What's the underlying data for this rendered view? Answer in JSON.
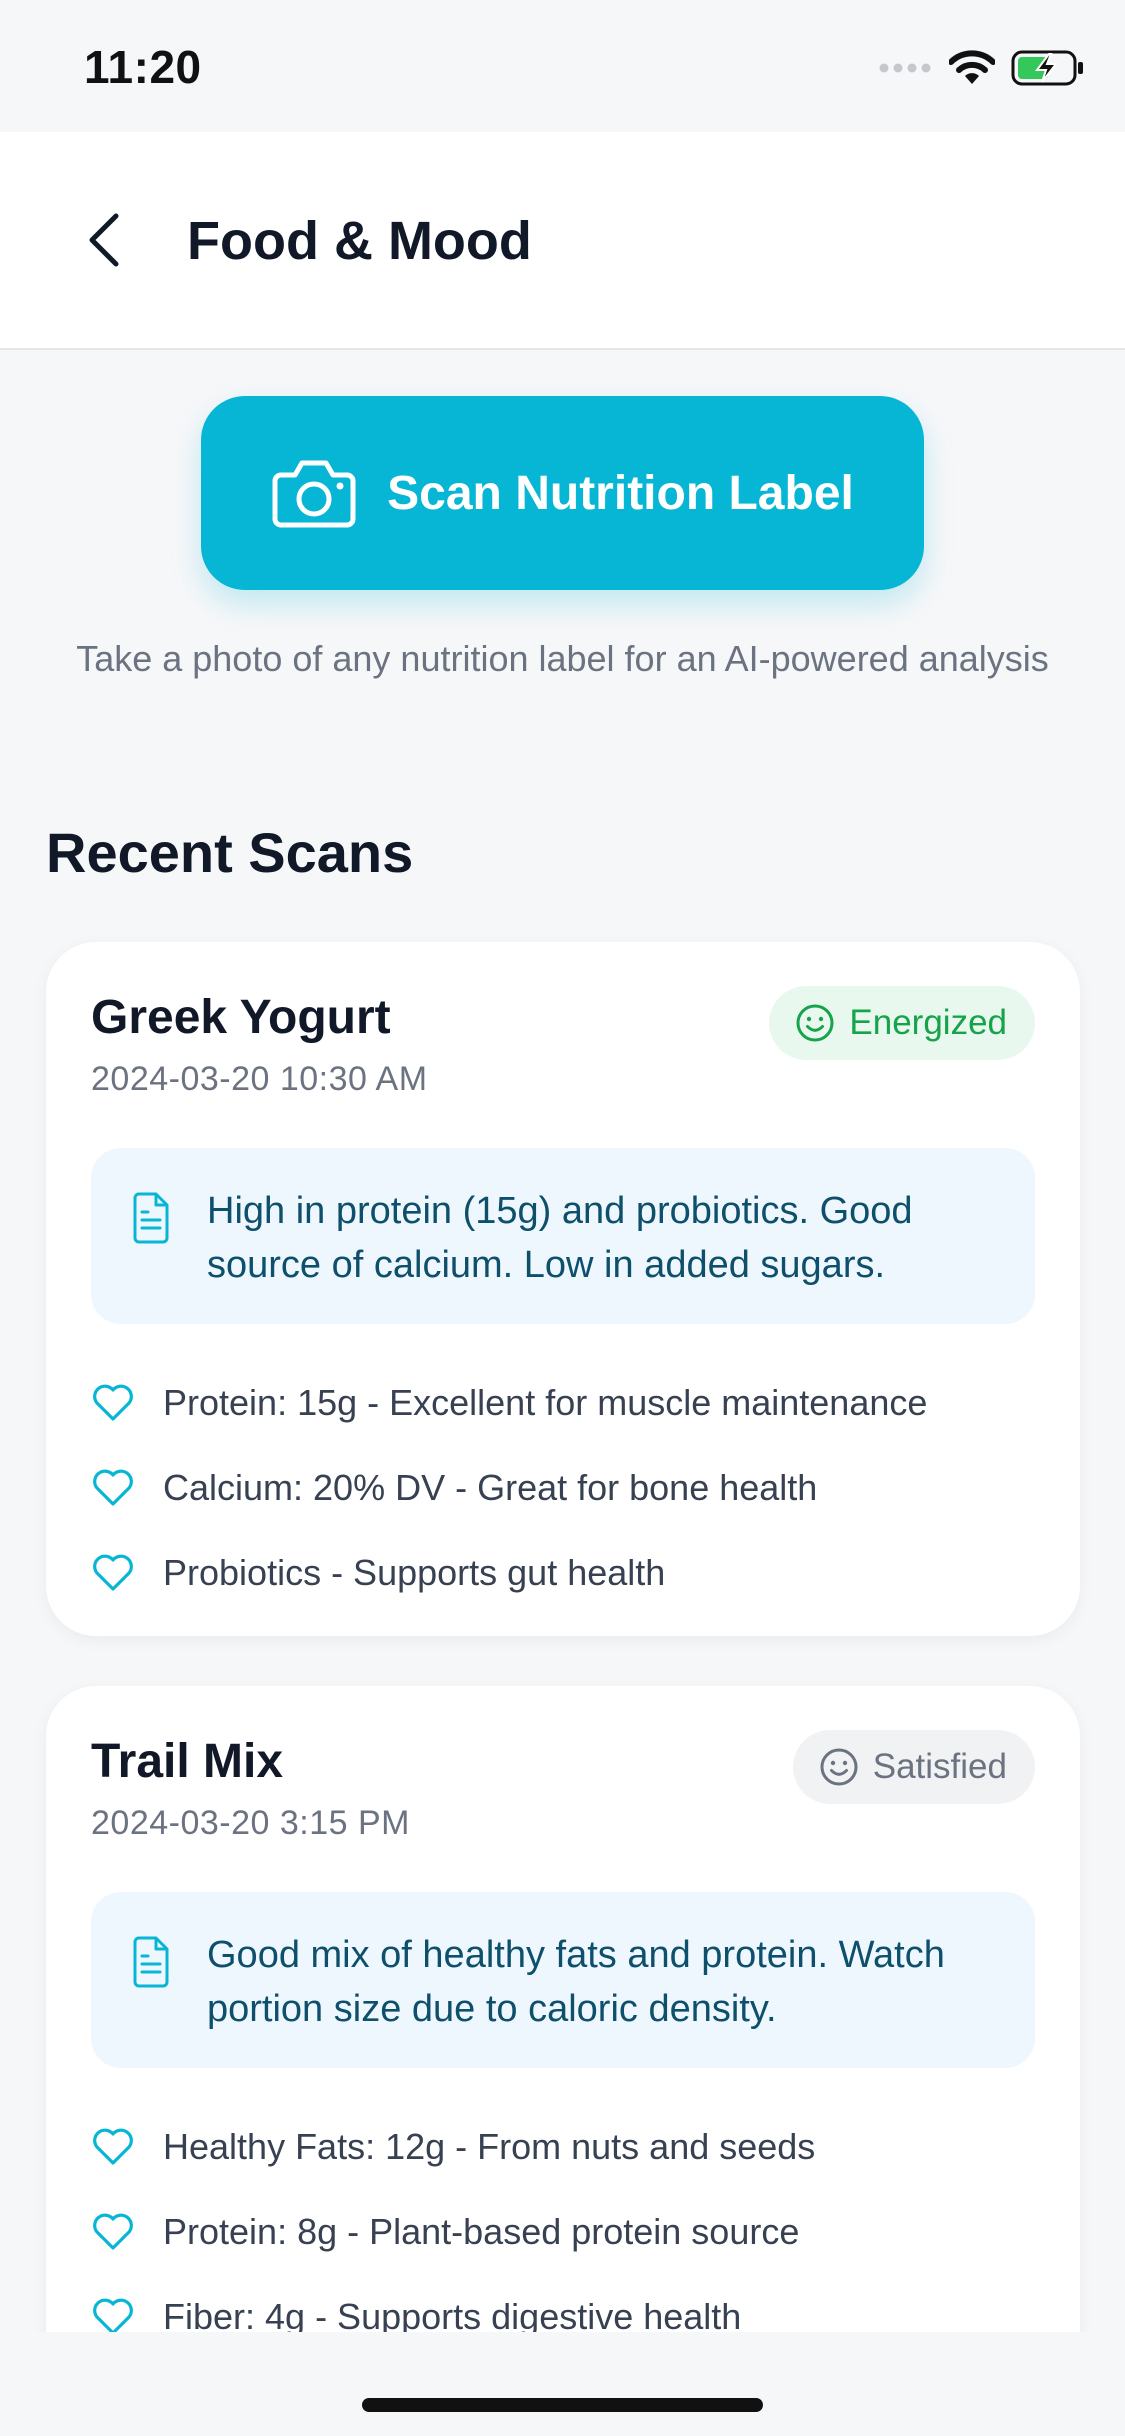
{
  "status_bar": {
    "time": "11:20"
  },
  "header": {
    "title": "Food & Mood",
    "back_icon": "chevron-left-icon"
  },
  "scan": {
    "button_label": "Scan Nutrition Label",
    "button_icon": "camera-icon",
    "caption": "Take a photo of any nutrition label for an AI-powered analysis",
    "accent_color": "#06b6d4"
  },
  "recent": {
    "title": "Recent Scans",
    "items": [
      {
        "name": "Greek Yogurt",
        "timestamp": "2024-03-20 10:30 AM",
        "mood": "Energized",
        "mood_color": "#16a34a",
        "analysis": "High in protein (15g) and probiotics. Good source of calcium. Low in added sugars.",
        "benefits": [
          "Protein: 15g - Excellent for muscle maintenance",
          "Calcium: 20% DV - Great for bone health",
          "Probiotics - Supports gut health"
        ]
      },
      {
        "name": "Trail Mix",
        "timestamp": "2024-03-20 3:15 PM",
        "mood": "Satisfied",
        "mood_color": "#6b7280",
        "analysis": "Good mix of healthy fats and protein. Watch portion size due to caloric density.",
        "benefits": [
          "Healthy Fats: 12g - From nuts and seeds",
          "Protein: 8g - Plant-based protein source",
          "Fiber: 4g - Supports digestive health"
        ]
      }
    ]
  }
}
